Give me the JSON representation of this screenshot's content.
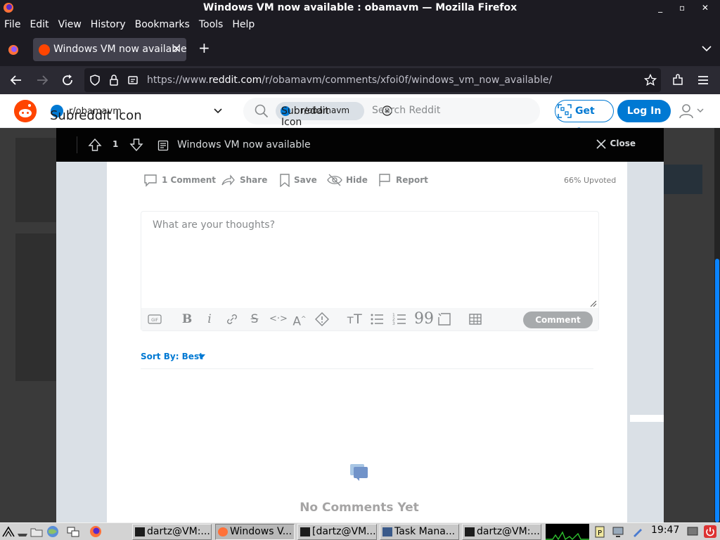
{
  "window": {
    "title": "Windows VM now available : obamavm — Mozilla Firefox",
    "controls": "_ ▫ ✕"
  },
  "menu": [
    "File",
    "Edit",
    "View",
    "History",
    "Bookmarks",
    "Tools",
    "Help"
  ],
  "tab": {
    "title": "Windows VM now available : obamavm",
    "close": "✕",
    "new_tab": "+"
  },
  "url": {
    "prefix": "https://www.",
    "domain": "reddit.com",
    "path": "/r/obamavm/comments/xfoi0f/windows_vm_now_available/"
  },
  "reddit": {
    "subreddit": "r/obamavm",
    "subreddit_icon_alt": "Subreddit Icon",
    "search_chip": "r/obamavm",
    "search_chip_alt": "Subreddit Icon",
    "search_placeholder": "Search Reddit",
    "get_app": "Get App",
    "log_in": "Log In"
  },
  "post": {
    "vote_count": "1",
    "title": "Windows VM now available",
    "close": "Close",
    "actions": {
      "comments": "1 Comment",
      "share": "Share",
      "save": "Save",
      "hide": "Hide",
      "report": "Report"
    },
    "upvoted": "66% Upvoted",
    "comment_placeholder": "What are your thoughts?",
    "comment_button": "Comment",
    "toolbar": [
      "gif",
      "bold",
      "italic",
      "link",
      "strikethrough",
      "inline-code",
      "superscript",
      "spoiler",
      "heading",
      "bulleted-list",
      "numbered-list",
      "quote-block",
      "code-block",
      "table"
    ],
    "sort_by": "Sort By: Best",
    "no_comments": "No Comments Yet"
  },
  "taskbar": {
    "tasks": [
      "dartz@VM:...",
      "Windows V...",
      "[dartz@VM...",
      "Task Mana...",
      "dartz@VM:..."
    ],
    "clock": "19:47"
  },
  "colors": {
    "reddit_orange": "#ff4500",
    "reddit_blue": "#0079d3",
    "firefox_dark": "#1c1b22",
    "scroll_thumb": "#0a84ff"
  }
}
